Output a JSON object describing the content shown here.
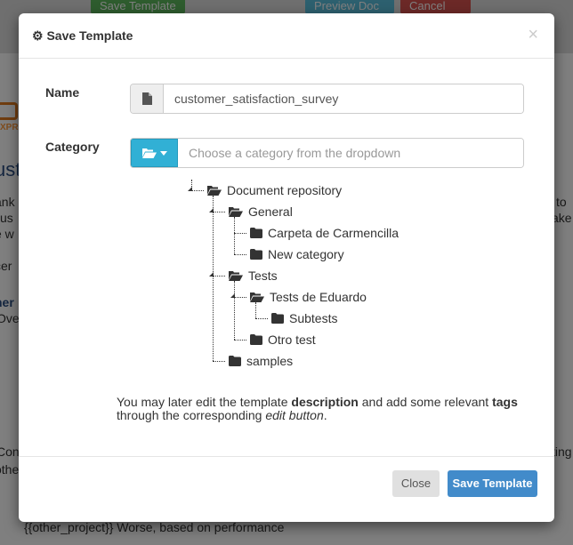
{
  "background": {
    "buttons": [
      {
        "label": "Save Template",
        "icon": "floppy-icon",
        "color": "#5cb85c"
      },
      {
        "label": "Preview Doc",
        "icon": "eye-icon",
        "color": "#5bc0de"
      },
      {
        "label": "Cancel",
        "icon": "times-icon",
        "color": "#d9534f"
      }
    ],
    "logo_text": "XPRE",
    "fragments_left": [
      "ust",
      "ank",
      "us",
      "e w",
      "cer",
      "ner",
      "Ove",
      "Con",
      "othe"
    ],
    "fragments_right": [
      "to",
      "ake",
      "ting"
    ],
    "bottom_line": "{{other_project}} Worse, based on performance"
  },
  "modal": {
    "title": "Save Template",
    "title_icon": "gear-icon",
    "close_symbol": "×",
    "name_label": "Name",
    "name_icon": "file-icon",
    "name_value": "customer_satisfaction_survey",
    "category_label": "Category",
    "category_icon": "folder-open-icon",
    "category_placeholder": "Choose a category from the dropdown",
    "tree": [
      {
        "label": "Document repository",
        "level": 0,
        "open": true
      },
      {
        "label": "General",
        "level": 1,
        "open": true
      },
      {
        "label": "Carpeta de Carmencilla",
        "level": 2,
        "open": false
      },
      {
        "label": "New category",
        "level": 2,
        "open": false
      },
      {
        "label": "Tests",
        "level": 1,
        "open": true
      },
      {
        "label": "Tests de Eduardo",
        "level": 2,
        "open": true
      },
      {
        "label": "Subtests",
        "level": 3,
        "open": false
      },
      {
        "label": "Otro test",
        "level": 2,
        "open": false
      },
      {
        "label": "samples",
        "level": 1,
        "open": false
      }
    ],
    "note": {
      "part1": "You may later edit the template ",
      "bold1": "description",
      "part2": " and add some relevant ",
      "bold2": "tags",
      "part3": " through the corresponding ",
      "italic": "edit button",
      "part4": "."
    },
    "close_button": "Close",
    "save_button": "Save Template",
    "save_color": "#428bca"
  }
}
